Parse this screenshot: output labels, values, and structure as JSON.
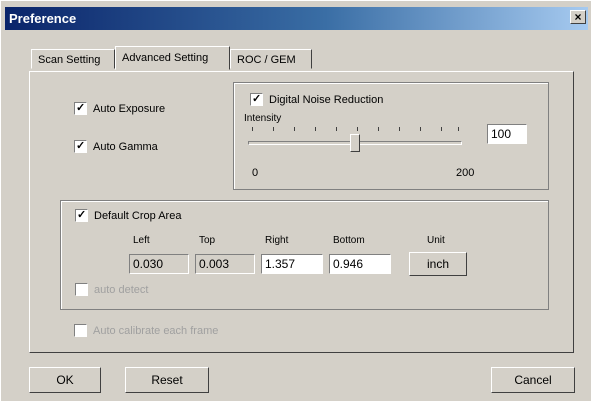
{
  "window": {
    "title": "Preference",
    "close_glyph": "×"
  },
  "tabs": [
    {
      "label": "Scan Setting",
      "active": false
    },
    {
      "label": "Advanced Setting",
      "active": true
    },
    {
      "label": "ROC / GEM",
      "active": false
    }
  ],
  "advanced": {
    "auto_exposure": {
      "label": "Auto Exposure",
      "checked": true
    },
    "auto_gamma": {
      "label": "Auto Gamma",
      "checked": true
    },
    "noise_reduction": {
      "label": "Digital Noise Reduction",
      "checked": true,
      "intensity_label": "Intensity",
      "min": "0",
      "max": "200",
      "value": "100",
      "slider_fraction": 0.5
    },
    "crop_area": {
      "label": "Default Crop Area",
      "checked": true,
      "left_label": "Left",
      "top_label": "Top",
      "right_label": "Right",
      "bottom_label": "Bottom",
      "unit_label": "Unit",
      "left": "0.030",
      "top": "0.003",
      "right": "1.357",
      "bottom": "0.946",
      "unit_button": "inch",
      "auto_detect": {
        "label": "auto detect",
        "checked": false
      }
    },
    "auto_calibrate": {
      "label": "Auto calibrate each frame",
      "checked": false
    }
  },
  "footer": {
    "ok": "OK",
    "reset": "Reset",
    "cancel": "Cancel"
  }
}
